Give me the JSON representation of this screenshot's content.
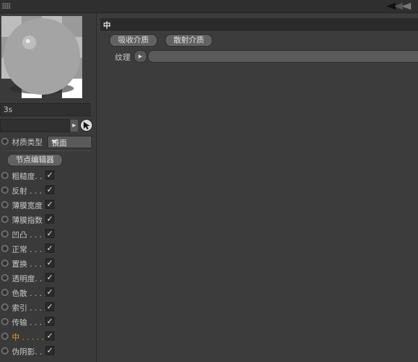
{
  "left_panel": {
    "material_name": "3s",
    "material_type": {
      "label": "材质类型",
      "value": "镜面"
    },
    "node_editor_label": "节点编辑器",
    "channels": [
      {
        "label": "粗糙度. . .",
        "checked": true,
        "active": false
      },
      {
        "label": "反射 . . . .",
        "checked": true,
        "active": false
      },
      {
        "label": "薄膜宽度",
        "checked": true,
        "active": false
      },
      {
        "label": "薄膜指数",
        "checked": true,
        "active": false
      },
      {
        "label": "凹凸 . . . .",
        "checked": true,
        "active": false
      },
      {
        "label": "正常 . . . .",
        "checked": true,
        "active": false
      },
      {
        "label": "置换 . . . .",
        "checked": true,
        "active": false
      },
      {
        "label": "透明度. . .",
        "checked": true,
        "active": false
      },
      {
        "label": "色散 . . . .",
        "checked": true,
        "active": false
      },
      {
        "label": "索引 . . . .",
        "checked": true,
        "active": false
      },
      {
        "label": "传输 . . . .",
        "checked": true,
        "active": false
      },
      {
        "label": "中 . . . . . .",
        "checked": true,
        "active": true
      },
      {
        "label": "伪阴影. . .",
        "checked": true,
        "active": false
      }
    ],
    "checkmark": "✓"
  },
  "right_panel": {
    "section_title": "中",
    "buttons": {
      "absorption": "吸收介质",
      "scattering": "散射介质"
    },
    "texture_label": "纹理"
  },
  "colors": {
    "active_channel": "#f0a020",
    "background": "#3c3c3c"
  },
  "icons": {
    "grip": "grip-icon",
    "nav_arrows": "nav-arrows-icon",
    "cursor": "pick-cursor-icon",
    "expand": "triangle-right-icon"
  }
}
